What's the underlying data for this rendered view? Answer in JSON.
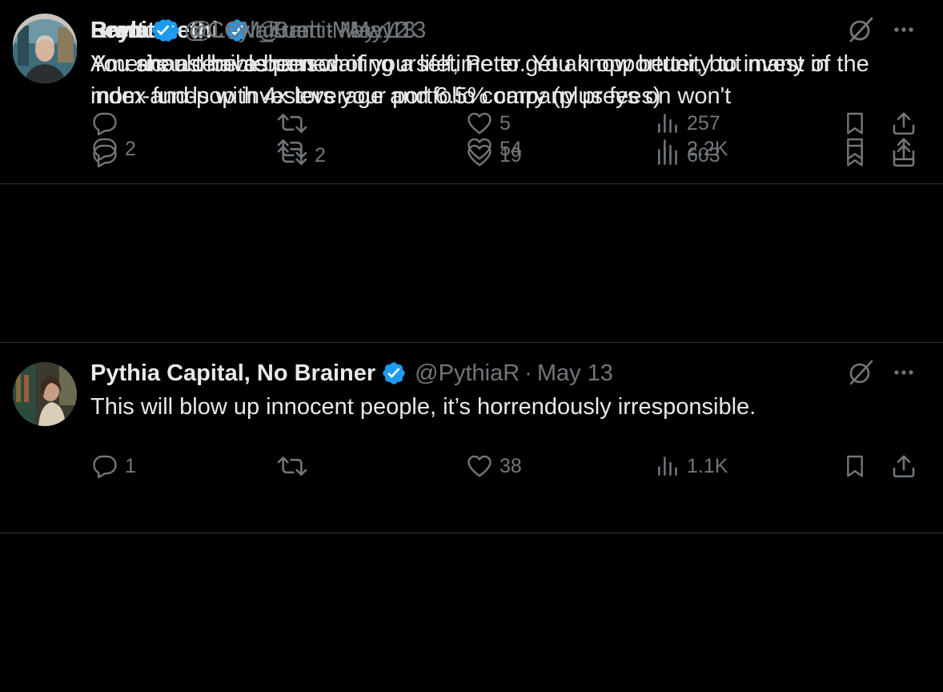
{
  "tweets": [
    {
      "name": "Ramit Sethi",
      "handle": "@ramit",
      "separator": "·",
      "date": "May 13",
      "text": "You should be ashamed of yourself, Peter. You know better, but many of the\nmom-and-pop investors your portfolio company preys on won't",
      "replies": "2",
      "retweets": "",
      "likes": "54",
      "views": "2.2K"
    },
    {
      "name": "Pythia Capital, No Brainer",
      "handle": "@PythiaR",
      "separator": "·",
      "date": "May 13",
      "text": "This will blow up innocent people, it’s horrendously irresponsible.",
      "replies": "1",
      "retweets": "",
      "likes": "38",
      "views": "1.1K"
    },
    {
      "name": "Leyla",
      "handle": "@LeylaKuni",
      "separator": "·",
      "date": "May 12",
      "text": "Americans have been waiting a lifetime to get an opportunity to invest in\nindex funds with 4x leverage and 6.5% carry (plus fees)",
      "replies": "",
      "retweets": "2",
      "likes": "19",
      "views": "603"
    },
    {
      "name": "Brett",
      "handle": "@CCM_Brett",
      "separator": "·",
      "date": "May 13",
      "text": "You are a terrible person",
      "replies": "",
      "retweets": "",
      "likes": "5",
      "views": "257"
    }
  ],
  "icons": {
    "verified": "verified-badge-icon",
    "grok": "grok-icon",
    "more": "more-icon",
    "reply": "reply-icon",
    "retweet": "retweet-icon",
    "like": "like-icon",
    "views": "views-icon",
    "bookmark": "bookmark-icon",
    "share": "share-icon"
  },
  "colors": {
    "background": "#000000",
    "text": "#e7e9ea",
    "muted": "#71767b",
    "divider": "#2f3336",
    "verified": "#1d9bf0"
  }
}
